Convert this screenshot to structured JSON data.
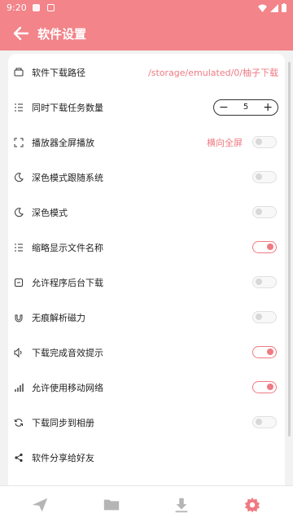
{
  "status": {
    "time": "9:20"
  },
  "appbar": {
    "title": "软件设置"
  },
  "settings": {
    "download_path": {
      "label": "软件下载路径",
      "value": "/storage/emulated/0/柚子下载"
    },
    "concurrent": {
      "label": "同时下载任务数量",
      "value": "5",
      "minus": "−",
      "plus": "+"
    },
    "fullscreen": {
      "label": "播放器全屏播放",
      "value": "横向全屏",
      "on": false
    },
    "dark_follow": {
      "label": "深色模式跟随系统",
      "on": false
    },
    "dark": {
      "label": "深色模式",
      "on": false
    },
    "abbrev": {
      "label": "缩略显示文件名称",
      "on": true
    },
    "background": {
      "label": "允许程序后台下载",
      "on": false
    },
    "magnet": {
      "label": "无痕解析磁力",
      "on": false
    },
    "sound": {
      "label": "下载完成音效提示",
      "on": true
    },
    "mobile": {
      "label": "允许使用移动网络",
      "on": true
    },
    "album": {
      "label": "下载同步到相册",
      "on": false
    },
    "share": {
      "label": "软件分享给好友"
    }
  },
  "colors": {
    "accent": "#f2848a",
    "toggle_on": "#ef7a82",
    "icon_gray": "#b5b5b5"
  },
  "bottom_nav": [
    "send-icon",
    "folder-icon",
    "download-icon",
    "settings-icon"
  ]
}
